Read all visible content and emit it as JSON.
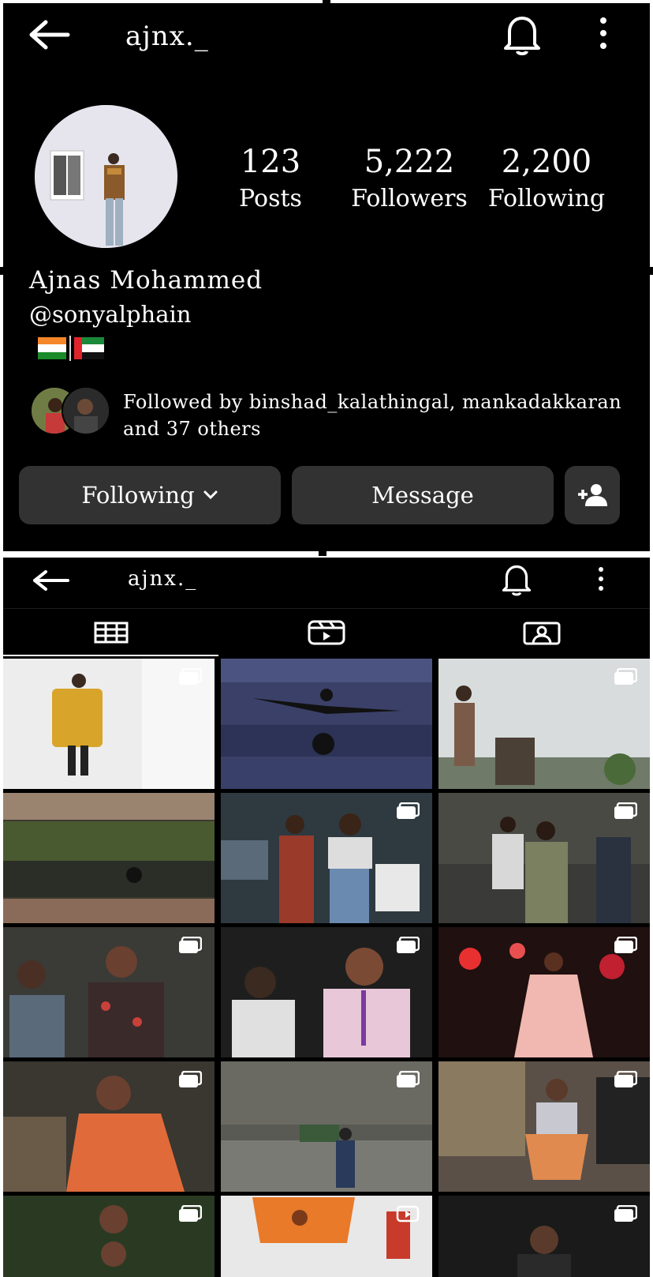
{
  "profile": {
    "username": "ajnx._",
    "stats": [
      {
        "value": "123",
        "label": "Posts"
      },
      {
        "value": "5,222",
        "label": "Followers"
      },
      {
        "value": "2,200",
        "label": "Following"
      }
    ],
    "display_name": "Ajnas Mohammed",
    "handle": "@sonyalphain",
    "followed_by_line1": "Followed by binshad_kalathingal, mankadakkaran",
    "followed_by_line2": "and 37 others"
  },
  "actions": {
    "following_label": "Following",
    "message_label": "Message"
  },
  "bottom_header": {
    "username": "ajnx._"
  },
  "tabs": [
    {
      "icon": "grid-icon",
      "selected": true
    },
    {
      "icon": "reels-icon",
      "selected": false
    },
    {
      "icon": "tagged-icon",
      "selected": false
    }
  ],
  "icons": {
    "back": "arrow-left-icon",
    "bell": "bell-icon",
    "more": "vertical-dots-icon",
    "chevron": "chevron-down-icon",
    "add_person": "person-add-icon",
    "multi_post": "carousel-icon"
  },
  "colors": {
    "background": "#000000",
    "button": "#323232",
    "text": "#ffffff"
  }
}
